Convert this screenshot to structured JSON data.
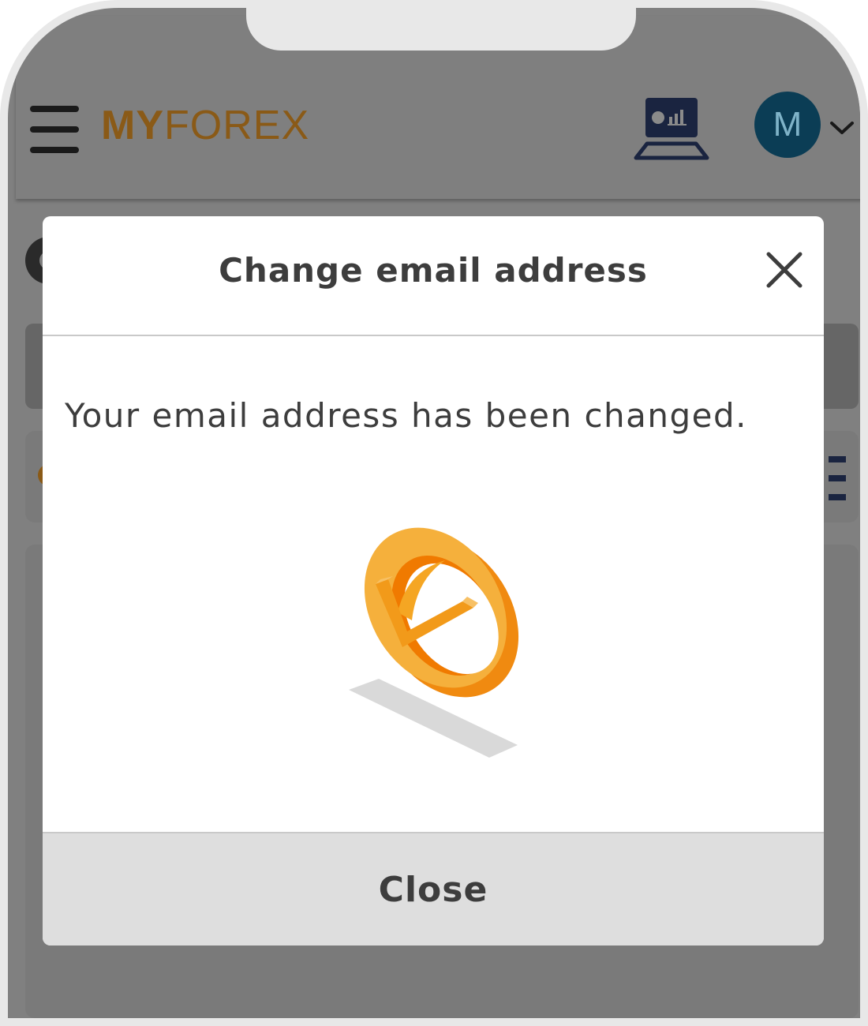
{
  "header": {
    "logo_my": "MY",
    "logo_forex": "FOREX",
    "avatar_initial": "M",
    "trade_icon": "trading-terminal-icon",
    "menu_icon": "hamburger-menu-icon"
  },
  "modal": {
    "title": "Change email address",
    "message": "Your email address has been changed.",
    "close_button_label": "Close",
    "success_icon": "checkmark-ring-icon"
  },
  "colors": {
    "brand": "#8a5a17",
    "avatar_bg": "#0b3d55",
    "overlay": "#808080",
    "success_orange": "#f5a623"
  }
}
